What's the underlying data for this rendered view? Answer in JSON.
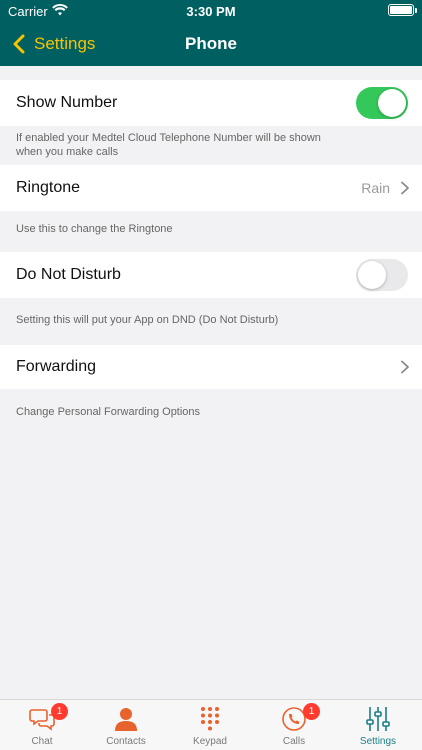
{
  "status_bar": {
    "carrier": "Carrier",
    "time": "3:30 PM"
  },
  "nav": {
    "back_label": "Settings",
    "title": "Phone"
  },
  "settings": {
    "show_number": {
      "label": "Show Number",
      "enabled": true,
      "footnote_line1": "If enabled your Medtel Cloud Telephone Number will be shown",
      "footnote_line2": "when you make calls"
    },
    "ringtone": {
      "label": "Ringtone",
      "value": "Rain",
      "footnote": "Use this to change the Ringtone"
    },
    "dnd": {
      "label": "Do Not Disturb",
      "enabled": false,
      "footnote": "Setting this will put your App on DND (Do Not Disturb)"
    },
    "forwarding": {
      "label": "Forwarding",
      "footnote": "Change Personal Forwarding Options"
    }
  },
  "tabs": [
    {
      "label": "Chat",
      "icon": "chat-icon",
      "badge": "1"
    },
    {
      "label": "Contacts",
      "icon": "contacts-icon"
    },
    {
      "label": "Keypad",
      "icon": "keypad-icon"
    },
    {
      "label": "Calls",
      "icon": "calls-icon",
      "badge": "1"
    },
    {
      "label": "Settings",
      "icon": "settings-sliders-icon"
    }
  ],
  "colors": {
    "header": "#005f60",
    "back_accent": "#f6c400",
    "toggle_on": "#34c759",
    "tab_icon": "#e8622c",
    "tab_active": "#1a7f86",
    "badge": "#ff3b30"
  }
}
